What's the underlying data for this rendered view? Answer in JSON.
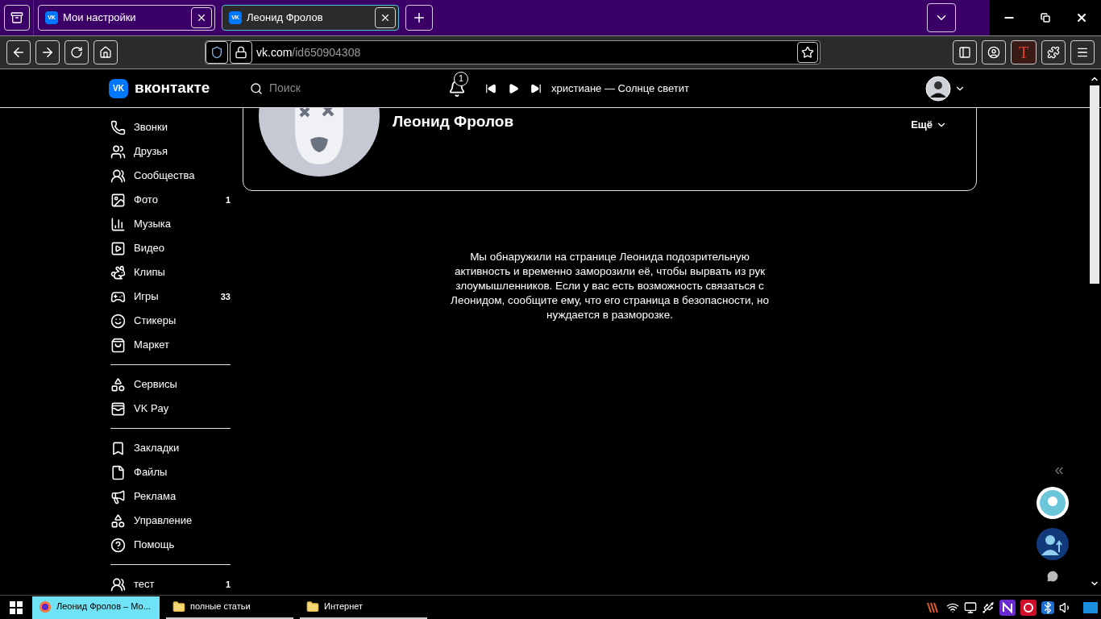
{
  "browser": {
    "tabs": [
      {
        "favicon": "VK",
        "title": "Мои настройки",
        "selected": false
      },
      {
        "favicon": "VK",
        "title": "Леонид Фролов",
        "selected": true
      }
    ],
    "address": {
      "host": "vk.com",
      "path": "/id650904308"
    },
    "extension_label": "T"
  },
  "vk_header": {
    "logo_mark": "VK",
    "logo_text": "вконтакте",
    "search_placeholder": "Поиск",
    "notifications_count": "1",
    "now_playing": "христиане — Солнце светит"
  },
  "sidebar": {
    "groups": [
      {
        "items": [
          {
            "label": "Звонки"
          },
          {
            "label": "Друзья"
          },
          {
            "label": "Сообщества"
          },
          {
            "label": "Фото",
            "count": "1"
          },
          {
            "label": "Музыка"
          },
          {
            "label": "Видео"
          },
          {
            "label": "Клипы"
          },
          {
            "label": "Игры",
            "count": "33"
          },
          {
            "label": "Стикеры"
          },
          {
            "label": "Маркет"
          }
        ]
      },
      {
        "items": [
          {
            "label": "Сервисы"
          },
          {
            "label": "VK Pay"
          }
        ]
      },
      {
        "items": [
          {
            "label": "Закладки"
          },
          {
            "label": "Файлы"
          },
          {
            "label": "Реклама"
          },
          {
            "label": "Управление"
          },
          {
            "label": "Помощь"
          }
        ]
      },
      {
        "items": [
          {
            "label": "тест",
            "count": "1"
          }
        ]
      }
    ]
  },
  "profile": {
    "name": "Леонид Фролов",
    "more_label": "Ещё"
  },
  "message": "Мы обнаружили на странице Леонида подозрительную активность и временно заморозили её, чтобы вырвать из рук злоумышленников. Если у вас есть возможность связаться с Леонидом, сообщите ему, что его страница в безопасности, но нуждается в разморозке.",
  "side_widgets": {
    "collapse_label": "«"
  },
  "taskbar": {
    "items": [
      {
        "label": "Леонид Фролов – Мо...",
        "selected": true
      },
      {
        "label": "полные статьи",
        "selected": false
      },
      {
        "label": "Интернет",
        "selected": false
      }
    ]
  }
}
